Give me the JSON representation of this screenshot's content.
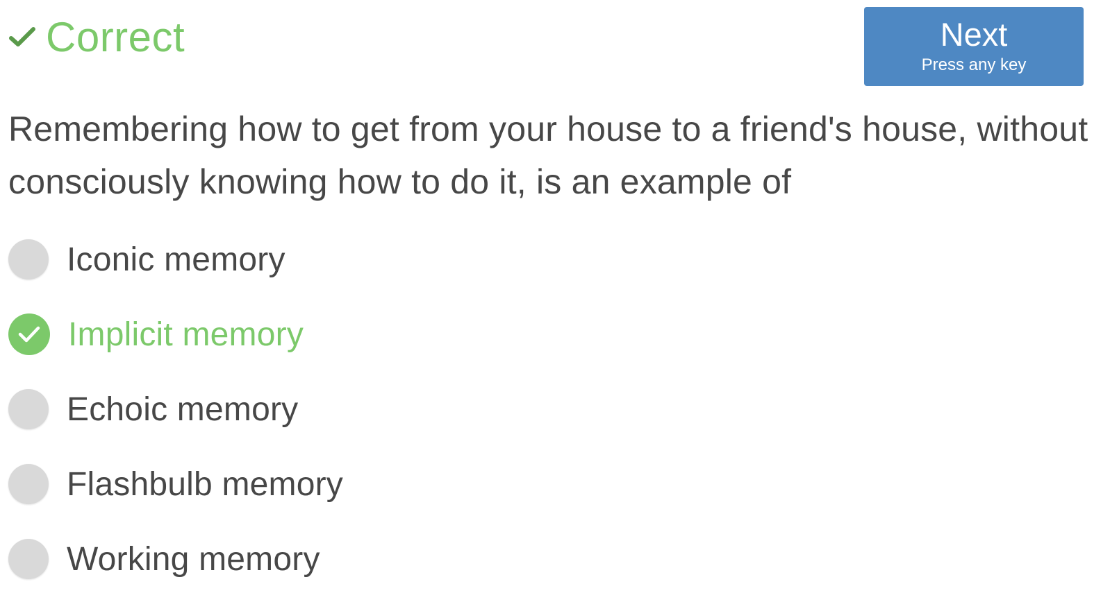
{
  "status": {
    "label": "Correct",
    "icon": "check-icon",
    "color": "#7cc96a"
  },
  "next_button": {
    "label": "Next",
    "hint": "Press any key",
    "color": "#4e88c3"
  },
  "question": {
    "text": "Remembering how to get from your house to a friend's house, without consciously knowing how to do it, is an example of"
  },
  "options": [
    {
      "label": "Iconic memory",
      "state": "unselected"
    },
    {
      "label": "Implicit memory",
      "state": "correct"
    },
    {
      "label": "Echoic memory",
      "state": "unselected"
    },
    {
      "label": "Flashbulb memory",
      "state": "unselected"
    },
    {
      "label": "Working memory",
      "state": "unselected"
    }
  ]
}
